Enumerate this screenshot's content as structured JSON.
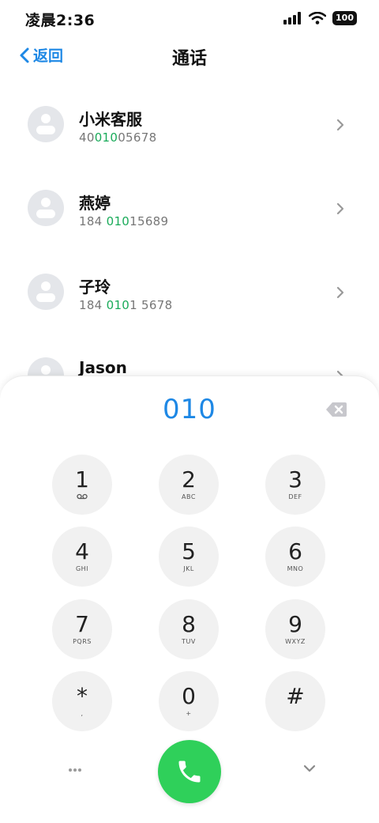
{
  "status_bar": {
    "time": "凌晨2:36",
    "battery": "100"
  },
  "nav": {
    "back_label": "返回",
    "title": "通话"
  },
  "contacts": [
    {
      "name": "小米客服",
      "number_pre": "40",
      "number_match": "010",
      "number_post": "05678"
    },
    {
      "name": "燕婷",
      "number_pre": "184 ",
      "number_match": "010",
      "number_post": "15689"
    },
    {
      "name": "子玲",
      "number_pre": "184 ",
      "number_match": "010",
      "number_post": "1 5678"
    },
    {
      "name": "Jason"
    }
  ],
  "dialpad": {
    "display": "010",
    "keys": [
      {
        "digit": "1",
        "sub": ""
      },
      {
        "digit": "2",
        "sub": "ABC"
      },
      {
        "digit": "3",
        "sub": "DEF"
      },
      {
        "digit": "4",
        "sub": "GHI"
      },
      {
        "digit": "5",
        "sub": "JKL"
      },
      {
        "digit": "6",
        "sub": "MNO"
      },
      {
        "digit": "7",
        "sub": "PQRS"
      },
      {
        "digit": "8",
        "sub": "TUV"
      },
      {
        "digit": "9",
        "sub": "WXYZ"
      },
      {
        "digit": "*",
        "sub": ","
      },
      {
        "digit": "0",
        "sub": "+"
      },
      {
        "digit": "#",
        "sub": ""
      }
    ]
  },
  "colors": {
    "accent": "#1e88e5",
    "match": "#1aab5a",
    "call": "#2fd05a",
    "key_bg": "#f1f1f1"
  },
  "icons": [
    "cellular-signal-icon",
    "wifi-icon",
    "battery-icon",
    "back-chevron-icon",
    "avatar-placeholder-icon",
    "chevron-right-icon",
    "backspace-icon",
    "voicemail-icon",
    "phone-icon",
    "more-dots-icon",
    "chevron-down-icon"
  ]
}
